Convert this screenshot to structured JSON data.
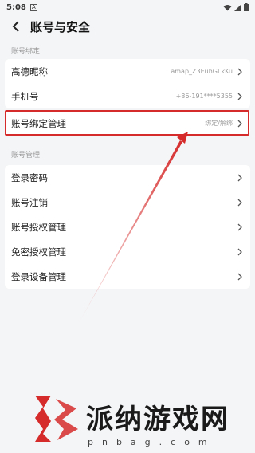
{
  "status": {
    "time": "5:08",
    "app_icon_letter": "A"
  },
  "header": {
    "title": "账号与安全"
  },
  "sections": [
    {
      "label": "账号绑定",
      "rows": [
        {
          "label": "高德昵称",
          "value": "amap_Z3EuhGLkKu"
        },
        {
          "label": "手机号",
          "value": "+86-191****5355"
        }
      ]
    },
    {
      "rows": [
        {
          "label": "账号绑定管理",
          "value": "绑定/解绑"
        }
      ]
    },
    {
      "label": "账号管理",
      "rows": [
        {
          "label": "登录密码",
          "value": ""
        },
        {
          "label": "账号注销",
          "value": ""
        },
        {
          "label": "账号授权管理",
          "value": ""
        },
        {
          "label": "免密授权管理",
          "value": ""
        },
        {
          "label": "登录设备管理",
          "value": ""
        }
      ]
    }
  ],
  "watermark": {
    "text": "派纳游戏网",
    "url": "pnbag.com"
  },
  "colors": {
    "highlight": "#d62b2b",
    "arrow": "#d62b2b"
  }
}
